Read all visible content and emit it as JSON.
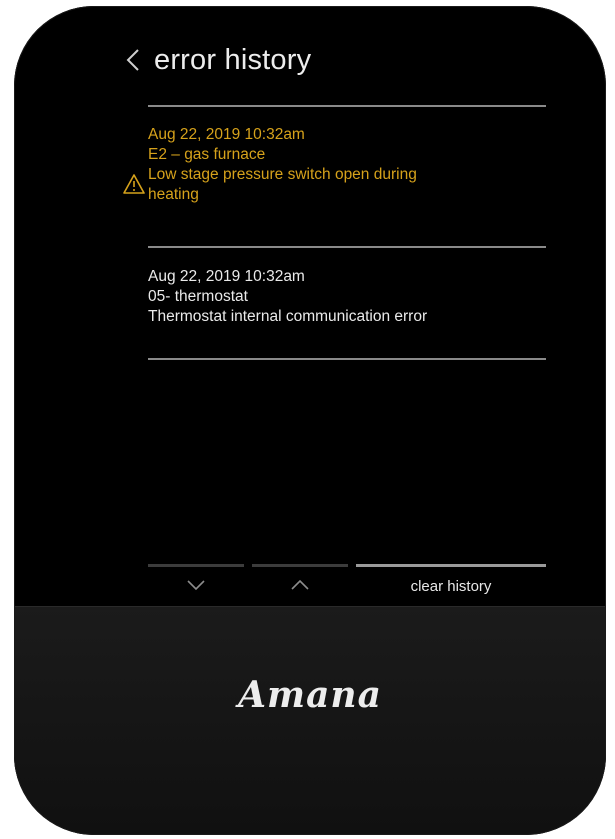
{
  "screen": {
    "title": "error history",
    "back_icon": "chevron-left-icon"
  },
  "entries": [
    {
      "timestamp": "Aug 22, 2019 10:32am",
      "code": "E2 – gas furnace",
      "message_line1": "Low stage pressure switch open during",
      "message_line2": "heating",
      "severity": "warning",
      "color": "#d6a21b",
      "icon": "warning-triangle-icon"
    },
    {
      "timestamp": "Aug 22, 2019 10:32am",
      "code": "05- thermostat",
      "message_line1": "Thermostat internal communication error",
      "severity": "normal",
      "color": "#eaeaea"
    }
  ],
  "controls": {
    "down_icon": "chevron-down-icon",
    "up_icon": "chevron-up-icon",
    "clear_label": "clear history"
  },
  "brand": {
    "logo_text": "Amana"
  }
}
